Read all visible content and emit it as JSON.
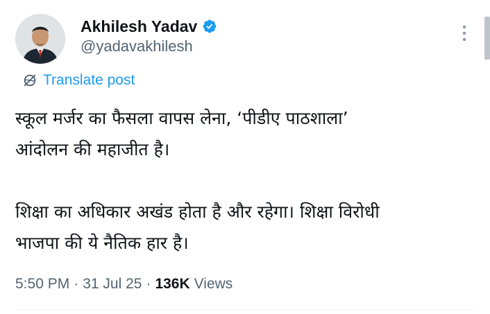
{
  "author": {
    "display_name": "Akhilesh Yadav",
    "handle": "@yadavakhilesh",
    "verified": true,
    "verified_badge_color": "#1d9bf0",
    "avatar_icon": "profile-photo"
  },
  "actions": {
    "more_icon": "more-vertical-icon",
    "translate_label": "Translate post",
    "translate_icon": "globe-icon"
  },
  "post": {
    "lines": [
      "स्कूल मर्जर का फैसला वापस लेना, ‘पीडीए पाठशाला’",
      "आंदोलन की महाजीत है।",
      "शिक्षा का अधिकार अखंड होता है और रहेगा। शिक्षा विरोधी",
      "भाजपा की ये नैतिक हार है।"
    ]
  },
  "meta": {
    "time": "5:50 PM",
    "separator": "·",
    "date": "31 Jul 25",
    "views_count": "136K",
    "views_label": "Views"
  },
  "colors": {
    "text_primary": "#0f1419",
    "text_secondary": "#536471",
    "accent": "#1d9bf0"
  }
}
